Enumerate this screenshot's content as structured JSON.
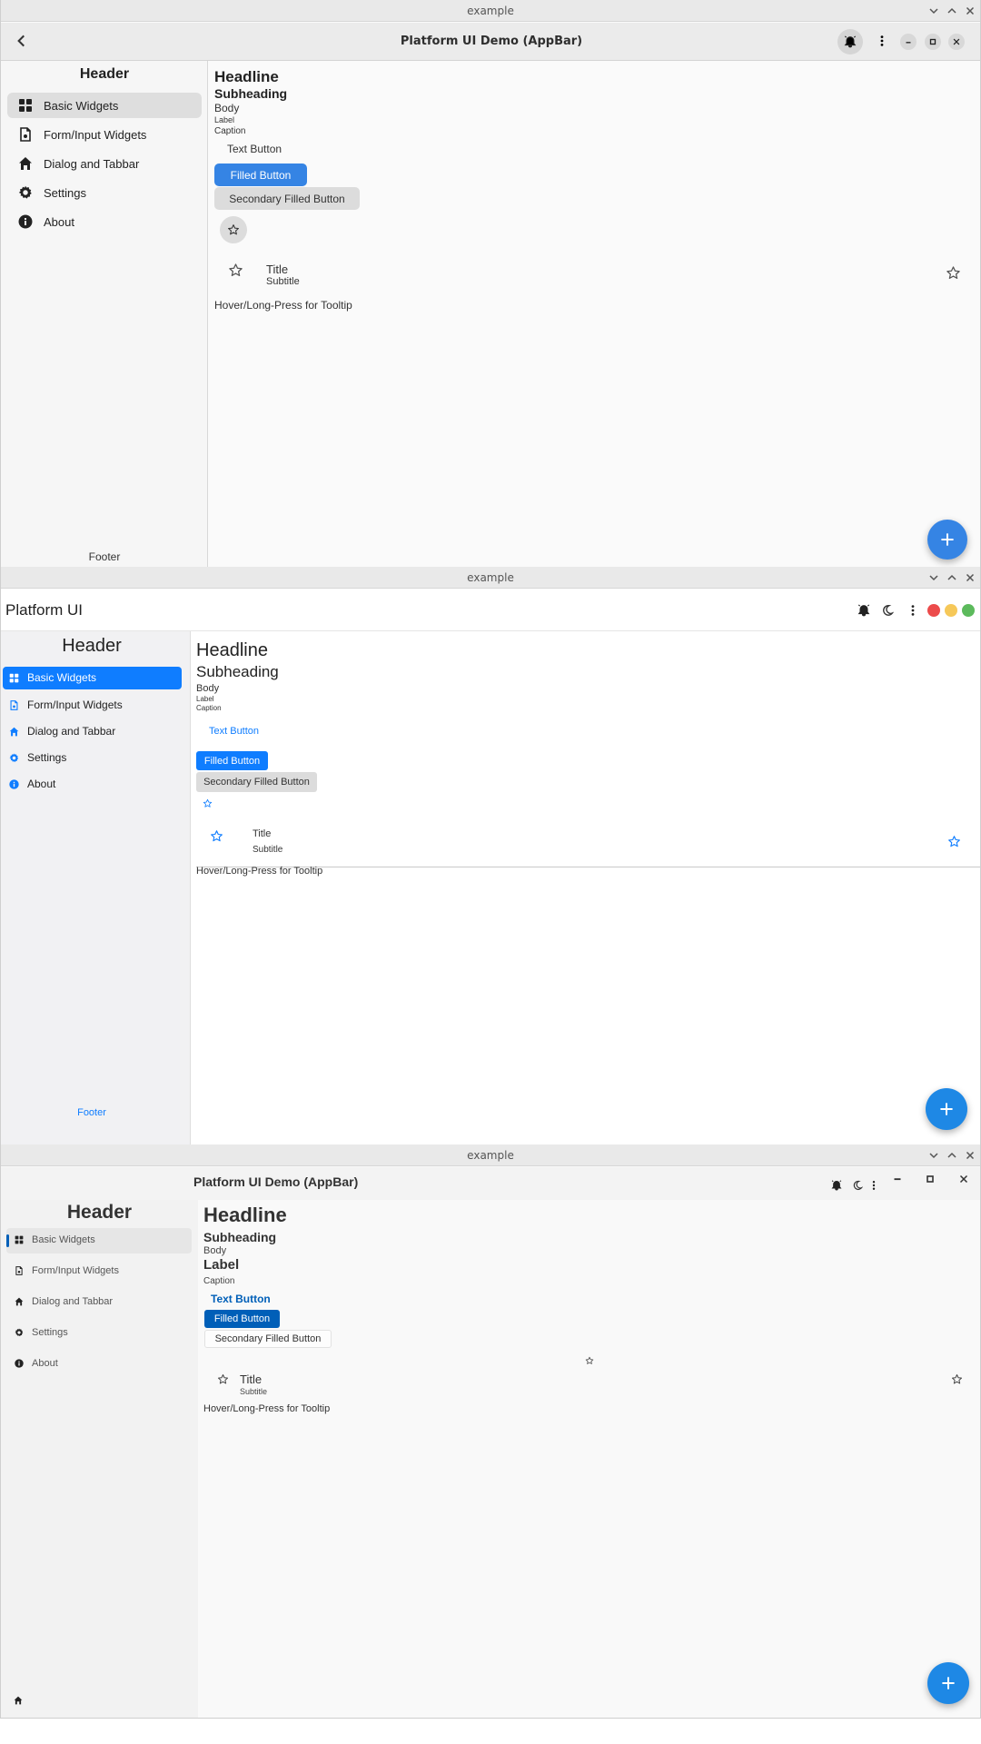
{
  "window_title": "example",
  "colors": {
    "accent_blue": "#1e88e5",
    "fluent_blue": "#0f7dff",
    "gnome_blue": "#3584e4",
    "winui_blue": "#005fb8"
  },
  "win1": {
    "appbar_title": "Platform UI Demo (AppBar)",
    "drawer_header": "Header",
    "drawer_footer": "Footer",
    "nav": [
      "Basic Widgets",
      "Form/Input Widgets",
      "Dialog and Tabbar",
      "Settings",
      "About"
    ],
    "headline": "Headline",
    "subheading": "Subheading",
    "body": "Body",
    "label": "Label",
    "caption": "Caption",
    "text_button": "Text Button",
    "filled_button": "Filled Button",
    "secondary_filled_button": "Secondary Filled Button",
    "list_title": "Title",
    "list_subtitle": "Subtitle",
    "tooltip_text": "Hover/Long-Press for Tooltip"
  },
  "win2": {
    "appbar_title": "Platform UI",
    "drawer_header": "Header",
    "drawer_footer": "Footer",
    "nav": [
      "Basic Widgets",
      "Form/Input Widgets",
      "Dialog and Tabbar",
      "Settings",
      "About"
    ],
    "headline": "Headline",
    "subheading": "Subheading",
    "body": "Body",
    "label": "Label",
    "caption": "Caption",
    "text_button": "Text Button",
    "filled_button": "Filled Button",
    "secondary_filled_button": "Secondary Filled Button",
    "list_title": "Title",
    "list_subtitle": "Subtitle",
    "tooltip_text": "Hover/Long-Press for Tooltip"
  },
  "win3": {
    "appbar_title": "Platform UI Demo (AppBar)",
    "drawer_header": "Header",
    "nav": [
      "Basic Widgets",
      "Form/Input Widgets",
      "Dialog and Tabbar",
      "Settings",
      "About"
    ],
    "headline": "Headline",
    "subheading": "Subheading",
    "body": "Body",
    "label": "Label",
    "caption": "Caption",
    "text_button": "Text Button",
    "filled_button": "Filled Button",
    "secondary_filled_button": "Secondary Filled Button",
    "list_title": "Title",
    "list_subtitle": "Subtitle",
    "tooltip_text": "Hover/Long-Press for Tooltip"
  }
}
